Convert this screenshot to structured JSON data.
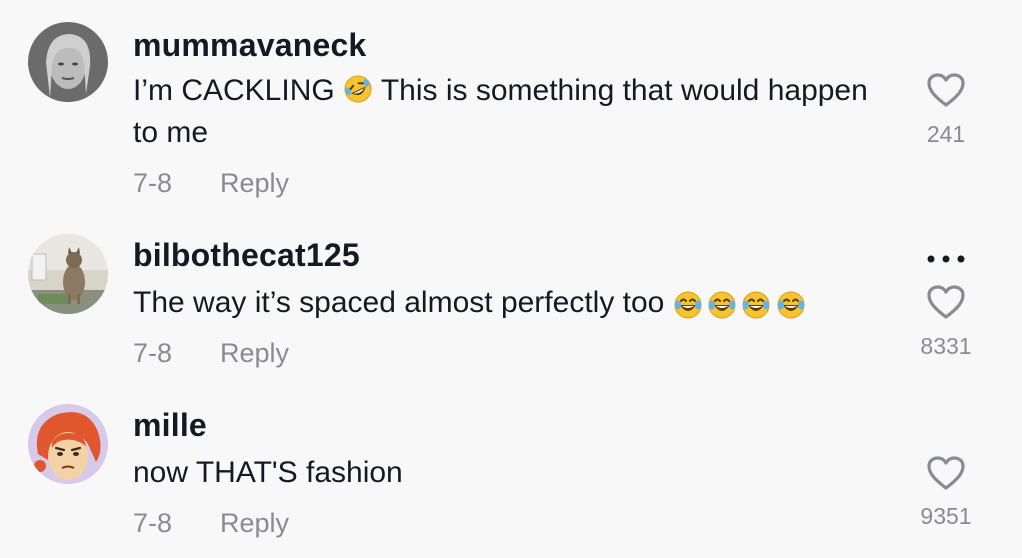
{
  "comments": [
    {
      "username": "mummavaneck",
      "text_before": "I’m CACKLING",
      "emoji": "rofl-emoji",
      "text_after": " This is something that would happen to me",
      "date": "7-8",
      "reply_label": "Reply",
      "likes": "241"
    },
    {
      "username": "bilbothecat125",
      "text": "The way it’s spaced almost perfectly too",
      "emoji": "tears-of-joy-emoji",
      "emoji_count": 4,
      "date": "7-8",
      "reply_label": "Reply",
      "likes": "8331",
      "has_more_menu": true
    },
    {
      "username": "mille",
      "text": "now THAT'S fashion",
      "date": "7-8",
      "reply_label": "Reply",
      "likes": "9351"
    }
  ],
  "icons": {
    "like": "heart-outline-icon",
    "more": "more-dots-icon"
  },
  "colors": {
    "background": "#f8f8f8",
    "text": "#161823",
    "muted": "#8a8b91"
  }
}
